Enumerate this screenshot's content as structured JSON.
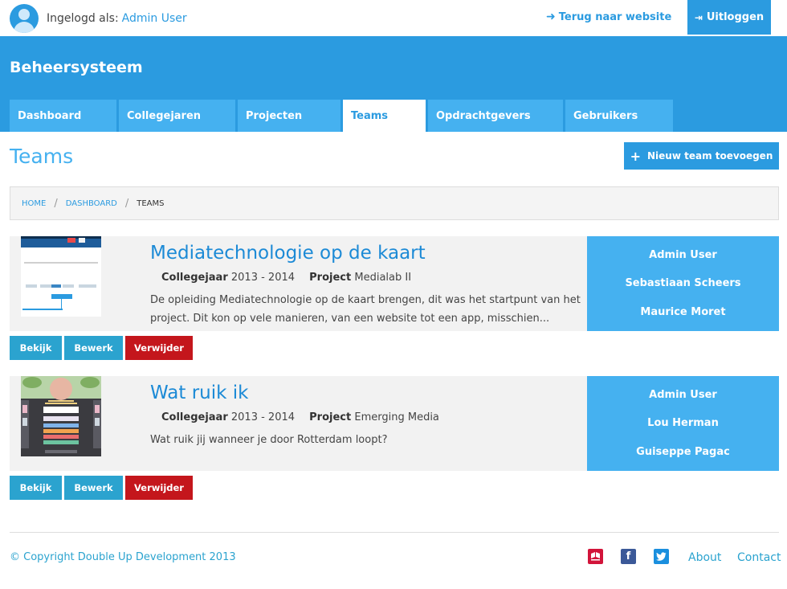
{
  "topbar": {
    "login_label": "Ingelogd als:",
    "login_user": "Admin User",
    "back_link": "Terug naar website",
    "logout": "Uitloggen"
  },
  "header": {
    "brand": "Beheersysteem",
    "tabs": [
      {
        "label": "Dashboard",
        "active": false
      },
      {
        "label": "Collegejaren",
        "active": false
      },
      {
        "label": "Projecten",
        "active": false
      },
      {
        "label": "Teams",
        "active": true
      },
      {
        "label": "Opdrachtgevers",
        "active": false
      },
      {
        "label": "Gebruikers",
        "active": false
      }
    ]
  },
  "page": {
    "title": "Teams",
    "new_button": "Nieuw team toevoegen"
  },
  "breadcrumb": {
    "items": [
      "HOME",
      "DASHBOARD",
      "TEAMS"
    ]
  },
  "teams": [
    {
      "title": "Mediatechnologie op de kaart",
      "year_label": "Collegejaar",
      "year": "2013 - 2014",
      "project_label": "Project",
      "project": "Medialab II",
      "description": "De opleiding Mediatechnologie op de kaart brengen, dit was het startpunt van het project. Dit kon op vele manieren, van een website tot een app, misschien...",
      "members": [
        "Admin User",
        "Sebastiaan Scheers",
        "Maurice Moret"
      ],
      "thumb_text": ""
    },
    {
      "title": "Wat ruik ik",
      "year_label": "Collegejaar",
      "year": "2013 - 2014",
      "project_label": "Project",
      "project": "Emerging Media",
      "description": "Wat ruik jij wanneer je door Rotterdam loopt?",
      "members": [
        "Admin User",
        "Lou Herman",
        "Guiseppe Pagac"
      ],
      "thumb_text": "WAT RUIK JE WANNEER JE DOOR ROTTERDAM LOOPT?"
    }
  ],
  "actions": {
    "view": "Bekijk",
    "edit": "Bewerk",
    "delete": "Verwijder"
  },
  "footer": {
    "copyright": "© Copyright Double Up Development 2013",
    "about": "About",
    "contact": "Contact",
    "icons": [
      "rotterdam-logo-icon",
      "facebook-icon",
      "twitter-icon"
    ]
  },
  "colors": {
    "primary": "#2b9be0",
    "tab": "#45b1f0",
    "danger": "#c4161c",
    "action": "#2ba3cf"
  }
}
